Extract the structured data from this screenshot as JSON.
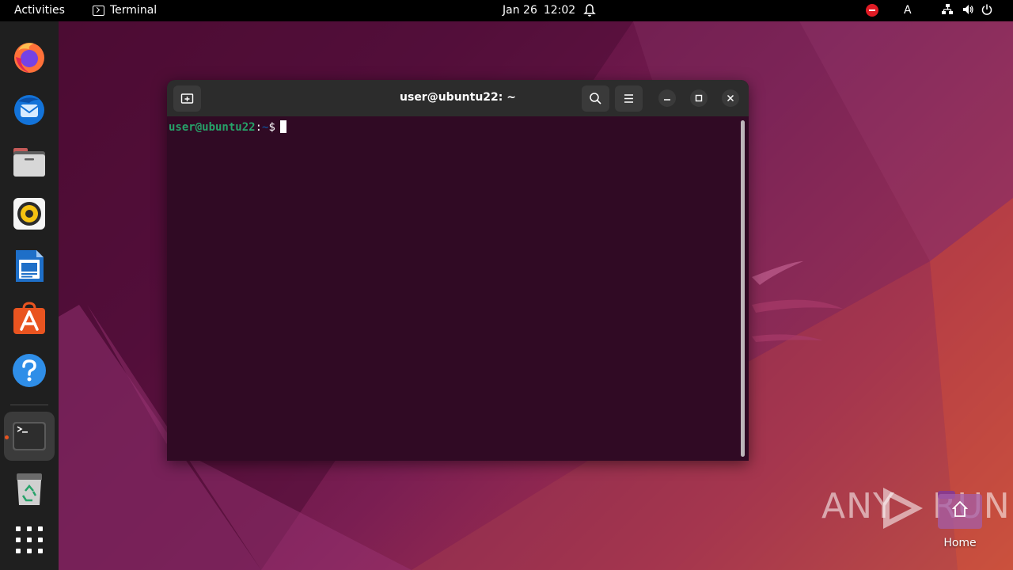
{
  "topbar": {
    "activities": "Activities",
    "app_name": "Terminal",
    "date": "Jan 26",
    "time": "12:02",
    "keyboard_layout": "A"
  },
  "dock": {
    "items": [
      {
        "name": "firefox",
        "icon": "firefox-icon"
      },
      {
        "name": "thunderbird",
        "icon": "thunderbird-icon"
      },
      {
        "name": "files",
        "icon": "files-icon"
      },
      {
        "name": "rhythmbox",
        "icon": "rhythmbox-icon"
      },
      {
        "name": "libreoffice-writer",
        "icon": "writer-icon"
      },
      {
        "name": "ubuntu-software",
        "icon": "software-icon"
      },
      {
        "name": "help",
        "icon": "help-icon"
      },
      {
        "name": "terminal",
        "icon": "terminal-icon",
        "active": true
      },
      {
        "name": "trash",
        "icon": "trash-icon"
      }
    ],
    "show_apps": "grid-icon"
  },
  "terminal": {
    "title": "user@ubuntu22: ~",
    "prompt_user": "user@ubuntu22",
    "prompt_sep": ":",
    "prompt_path": "~",
    "prompt_symbol": "$"
  },
  "desktop": {
    "home_label": "Home"
  },
  "watermark": {
    "left": "ANY",
    "right": "RUN"
  },
  "colors": {
    "accent": "#e95420",
    "terminal_bg": "#300a24",
    "prompt_user": "#26a269",
    "prompt_path": "#12488b"
  }
}
